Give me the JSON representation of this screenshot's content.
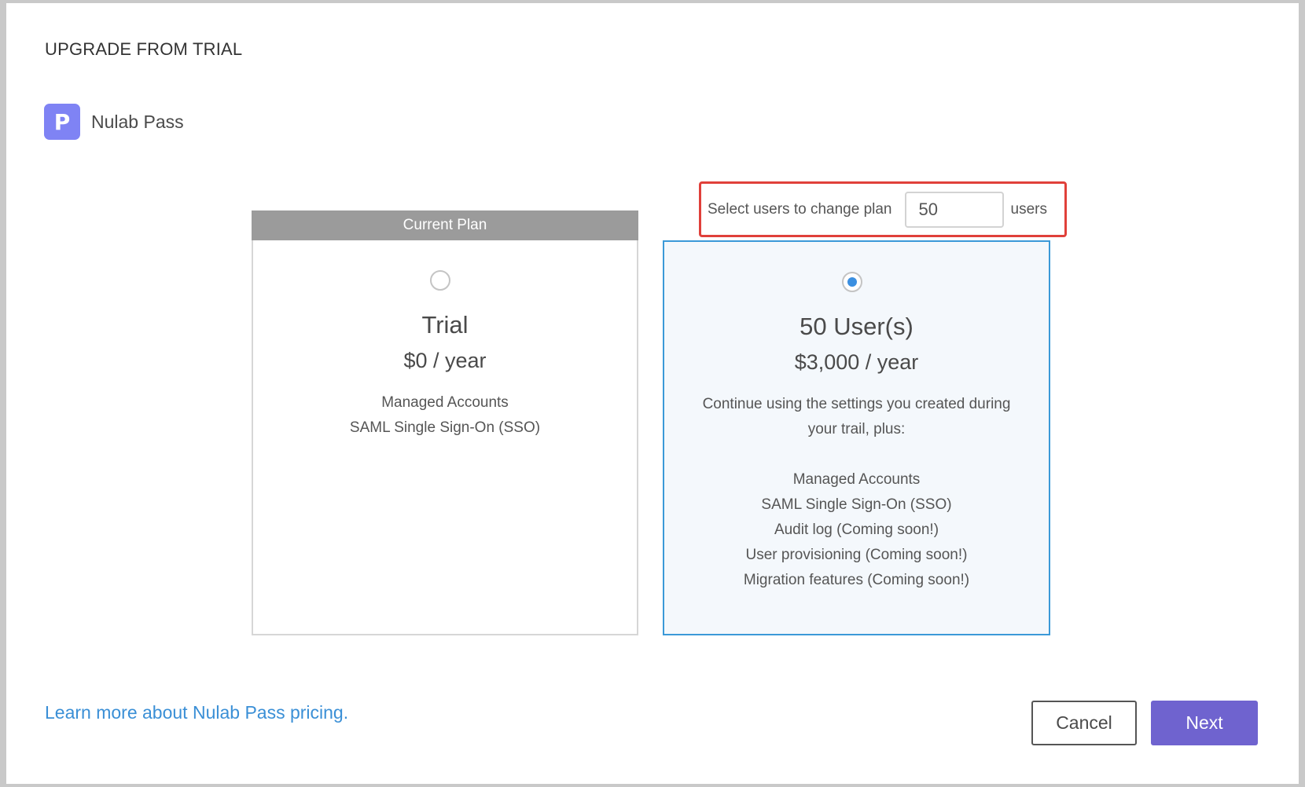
{
  "dialog": {
    "title": "UPGRADE FROM TRIAL"
  },
  "app": {
    "icon_letter": "P",
    "name": "Nulab Pass",
    "icon_color": "#7f83f4"
  },
  "user_selector": {
    "label": "Select users to change plan",
    "value": "50",
    "unit": "users"
  },
  "plans": [
    {
      "header": "Current Plan",
      "name": "Trial",
      "price": "$0 / year",
      "selected": false,
      "features": [
        "Managed Accounts",
        "SAML Single Sign-On (SSO)"
      ]
    },
    {
      "name": "50 User(s)",
      "price": "$3,000 / year",
      "selected": true,
      "description": "Continue using the settings you created during your trail, plus:",
      "features": [
        "Managed Accounts",
        "SAML Single Sign-On (SSO)",
        "Audit log (Coming soon!)",
        "User provisioning (Coming soon!)",
        "Migration features (Coming soon!)"
      ]
    }
  ],
  "footer": {
    "pricing_link": "Learn more about Nulab Pass pricing.",
    "cancel_label": "Cancel",
    "next_label": "Next"
  },
  "colors": {
    "accent": "#6f63cf",
    "selected_border": "#3b99d8",
    "highlight_border": "#e0403a",
    "link": "#3a8fd6"
  }
}
